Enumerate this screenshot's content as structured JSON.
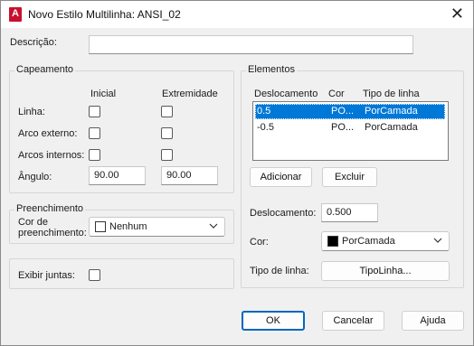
{
  "window": {
    "title": "Novo Estilo Multilinha: ANSI_02",
    "app_icon": "A"
  },
  "descricao": {
    "label": "Descrição:",
    "value": ""
  },
  "capeamento": {
    "title": "Capeamento",
    "col_inicial": "Inicial",
    "col_extremidade": "Extremidade",
    "rows": [
      {
        "label": "Linha:",
        "inicial": false,
        "extremidade": false
      },
      {
        "label": "Arco externo:",
        "inicial": false,
        "extremidade": false
      },
      {
        "label": "Arcos internos:",
        "inicial": false,
        "extremidade": false
      }
    ],
    "angulo_label": "Ângulo:",
    "angulo_inicial": "90.00",
    "angulo_extremidade": "90.00"
  },
  "preenchimento": {
    "title": "Preenchimento",
    "cor_label_line1": "Cor de",
    "cor_label_line2": "preenchimento:",
    "cor_value": "Nenhum",
    "swatch_color": "#ffffff"
  },
  "exibir_juntas": {
    "label": "Exibir juntas:",
    "checked": false
  },
  "elementos": {
    "title": "Elementos",
    "headers": [
      "Deslocamento",
      "Cor",
      "Tipo de linha"
    ],
    "rows": [
      {
        "deslocamento": "0.5",
        "cor": "PO...",
        "tipo": "PorCamada",
        "selected": true
      },
      {
        "deslocamento": "-0.5",
        "cor": "PO...",
        "tipo": "PorCamada",
        "selected": false
      }
    ],
    "adicionar": "Adicionar",
    "excluir": "Excluir",
    "deslocamento_label": "Deslocamento:",
    "deslocamento_value": "0.500",
    "cor_label": "Cor:",
    "cor_value": "PorCamada",
    "cor_swatch": "#000000",
    "tipo_linha_label": "Tipo de linha:",
    "tipo_linha_button": "TipoLinha..."
  },
  "footer": {
    "ok": "OK",
    "cancelar": "Cancelar",
    "ajuda": "Ajuda"
  },
  "colors": {
    "accent": "#0067c0",
    "selection": "#0078d7",
    "app_icon_red": "#c8102e"
  }
}
